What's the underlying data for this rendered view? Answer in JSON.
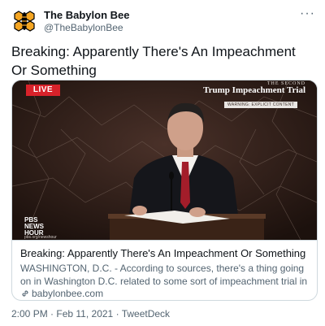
{
  "account": {
    "name": "The Babylon Bee",
    "handle": "@TheBabylonBee",
    "more_icon": "more-icon",
    "avatar_icon": "bee-logo"
  },
  "tweet": {
    "text": "Breaking: Apparently There's An Impeachment Or Something"
  },
  "card": {
    "overlay": {
      "live": "LIVE",
      "trial_prefix": "THE SECOND",
      "trial_title": "Trump Impeachment Trial",
      "warning": "WARNING: EXPLICIT CONTENT",
      "network_line1": "PBS",
      "network_line2": "NEWS",
      "network_line3": "HOUR",
      "network_url": "pbs.org/newshour"
    },
    "title": "Breaking: Apparently There's An Impeachment Or Something",
    "description": "WASHINGTON, D.C. - According to sources, there's a thing going on in Washington D.C. related to some sort of impeachment trial in the Senate, but we'...",
    "domain": "babylonbee.com",
    "domain_icon": "link-icon"
  },
  "meta": {
    "time": "2:00 PM",
    "separator": "·",
    "date": "Feb 11, 2021",
    "app": "TweetDeck"
  },
  "colors": {
    "text_primary": "#0f1419",
    "text_secondary": "#536471",
    "border": "#cfd9de",
    "live_red": "#d8222a",
    "bee_yellow": "#f5a623"
  }
}
